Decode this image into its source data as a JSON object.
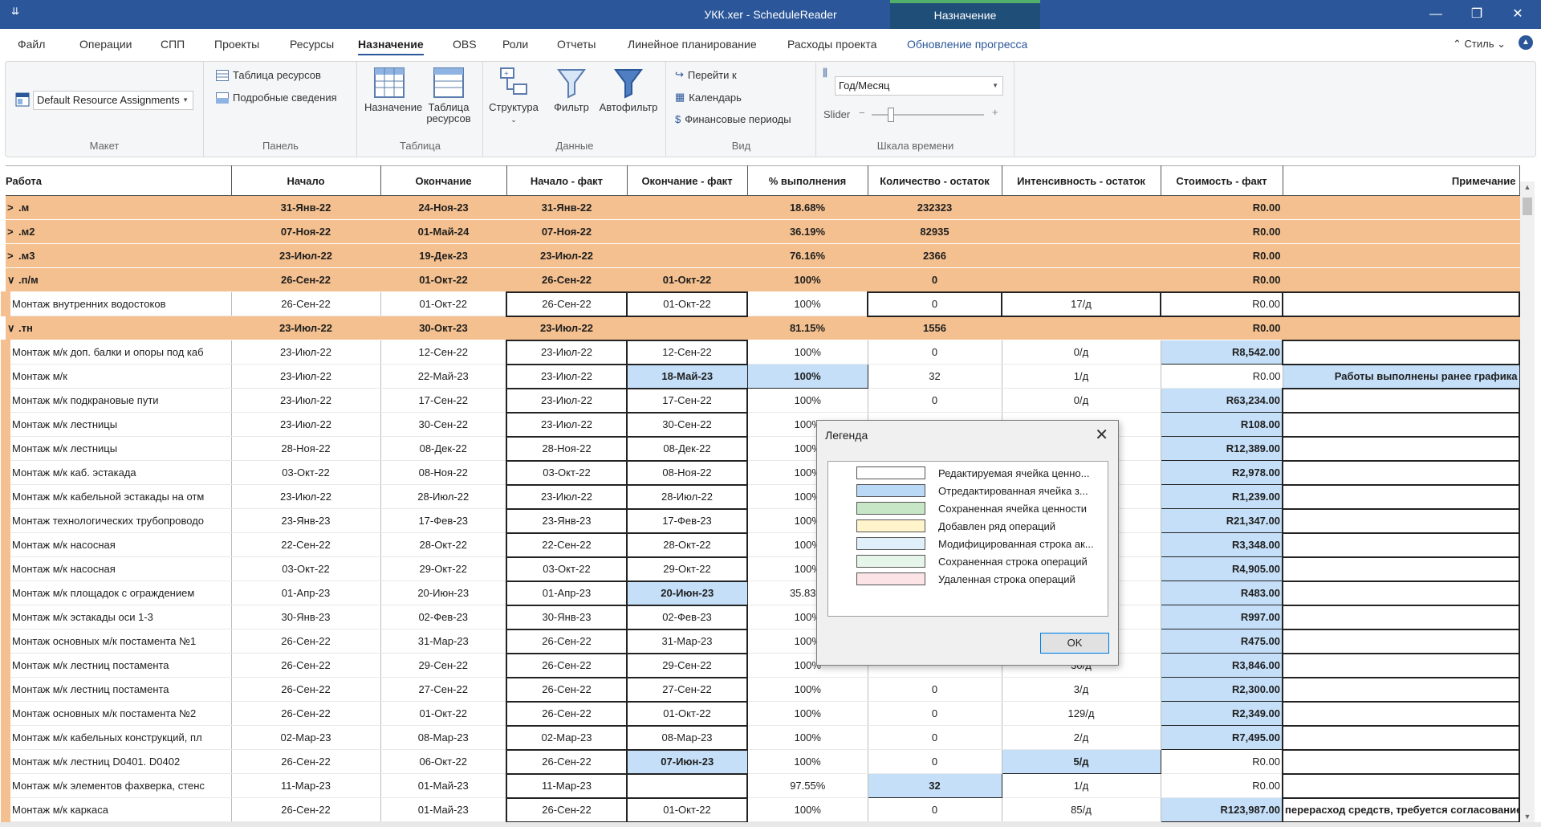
{
  "window": {
    "qa_menu": "⇊",
    "title": "УКК.xer - ScheduleReader",
    "context_tab": "Назначение",
    "buttons": {
      "minimize": "—",
      "restore": "❐",
      "close": "✕"
    }
  },
  "ribbon_tabs": [
    {
      "label": "Файл"
    },
    {
      "label": "Операции"
    },
    {
      "label": "СПП"
    },
    {
      "label": "Проекты"
    },
    {
      "label": "Ресурсы"
    },
    {
      "label": "Назначение",
      "active": true
    },
    {
      "label": "OBS"
    },
    {
      "label": "Роли"
    },
    {
      "label": "Отчеты"
    },
    {
      "label": "Линейное планирование"
    },
    {
      "label": "Расходы проекта"
    },
    {
      "label": "Обновление прогресса"
    }
  ],
  "style_menu": "⌃ Стиль ⌄",
  "ribbon": {
    "maket": {
      "caption": "Макет",
      "layout_value": "Default Resource Assignments"
    },
    "panel": {
      "caption": "Панель",
      "resource_table": "Таблица ресурсов",
      "details": "Подробные сведения"
    },
    "table": {
      "caption": "Таблица",
      "assignment": "Назначение",
      "resource_table_1": "Таблица",
      "resource_table_2": "ресурсов"
    },
    "data": {
      "caption": "Данные",
      "structure": "Структура",
      "filter": "Фильтр",
      "autofilter": "Автофильтр"
    },
    "view": {
      "caption": "Вид",
      "goto": "Перейти к",
      "calendar": "Календарь",
      "fin_periods": "Финансовые периоды"
    },
    "timescale": {
      "caption": "Шкала времени",
      "value": "Год/Месяц",
      "slider_label": "Slider",
      "slider_level": 0.15
    }
  },
  "columns": [
    "Работа",
    "Начало",
    "Окончание",
    "Начало - факт",
    "Окончание - факт",
    "% выполнения",
    "Количество - остаток",
    "Интенсивность - остаток",
    "Стоимость - факт",
    "Примечание"
  ],
  "rows": [
    {
      "g": 1,
      "caret": ">",
      "c": [
        ".м",
        "31-Янв-22",
        "24-Ноя-23",
        "31-Янв-22",
        "",
        "18.68%",
        "232323",
        "",
        "R0.00",
        ""
      ]
    },
    {
      "g": 1,
      "caret": ">",
      "c": [
        ".м2",
        "07-Ноя-22",
        "01-Май-24",
        "07-Ноя-22",
        "",
        "36.19%",
        "82935",
        "",
        "R0.00",
        ""
      ]
    },
    {
      "g": 1,
      "caret": ">",
      "c": [
        ".м3",
        "23-Июл-22",
        "19-Дек-23",
        "23-Июл-22",
        "",
        "76.16%",
        "2366",
        "",
        "R0.00",
        ""
      ]
    },
    {
      "g": 1,
      "caret": "∨",
      "c": [
        ".п/м",
        "26-Сен-22",
        "01-Окт-22",
        "26-Сен-22",
        "01-Окт-22",
        "100%",
        "0",
        "",
        "R0.00",
        ""
      ]
    },
    {
      "g": 0,
      "c": [
        "Монтаж внутренних водостоков",
        "26-Сен-22",
        "01-Окт-22",
        "26-Сен-22",
        "01-Окт-22",
        "100%",
        "0",
        "17/д",
        "R0.00",
        ""
      ],
      "ed": [
        3,
        4,
        6,
        7,
        8,
        9
      ]
    },
    {
      "g": 1,
      "caret": "∨",
      "c": [
        ".тн",
        "23-Июл-22",
        "30-Окт-23",
        "23-Июл-22",
        "",
        "81.15%",
        "1556",
        "",
        "R0.00",
        ""
      ]
    },
    {
      "g": 0,
      "c": [
        "Монтаж м/к доп. балки и опоры под каб",
        "23-Июл-22",
        "12-Сен-22",
        "23-Июл-22",
        "12-Сен-22",
        "100%",
        "0",
        "0/д",
        "R8,542.00",
        ""
      ],
      "ed": [
        3,
        4,
        9
      ],
      "mod": [
        8
      ]
    },
    {
      "g": 0,
      "c": [
        "Монтаж м/к",
        "23-Июл-22",
        "22-Май-23",
        "23-Июл-22",
        "18-Май-23",
        "100%",
        "32",
        "1/д",
        "R0.00",
        "Работы выполнены ранее графика"
      ],
      "ed": [
        3
      ],
      "mod": [
        4,
        5,
        9
      ]
    },
    {
      "g": 0,
      "c": [
        "Монтаж м/к подкрановые пути",
        "23-Июл-22",
        "17-Сен-22",
        "23-Июл-22",
        "17-Сен-22",
        "100%",
        "0",
        "0/д",
        "R63,234.00",
        ""
      ],
      "ed": [
        3,
        4,
        9
      ],
      "mod": [
        8
      ]
    },
    {
      "g": 0,
      "c": [
        "Монтаж м/к лестницы",
        "23-Июл-22",
        "30-Сен-22",
        "23-Июл-22",
        "30-Сен-22",
        "100%",
        "",
        "",
        "R108.00",
        ""
      ],
      "ed": [
        3,
        4,
        9
      ],
      "mod": [
        8
      ]
    },
    {
      "g": 0,
      "c": [
        "Монтаж м/к лестницы",
        "28-Ноя-22",
        "08-Дек-22",
        "28-Ноя-22",
        "08-Дек-22",
        "100%",
        "",
        "",
        "R12,389.00",
        ""
      ],
      "ed": [
        3,
        4,
        9
      ],
      "mod": [
        8
      ]
    },
    {
      "g": 0,
      "c": [
        "Монтаж м/к каб. эстакада",
        "03-Окт-22",
        "08-Ноя-22",
        "03-Окт-22",
        "08-Ноя-22",
        "100%",
        "",
        "",
        "R2,978.00",
        ""
      ],
      "ed": [
        3,
        4,
        9
      ],
      "mod": [
        8
      ]
    },
    {
      "g": 0,
      "c": [
        "Монтаж м/к кабельной эстакады на отм",
        "23-Июл-22",
        "28-Июл-22",
        "23-Июл-22",
        "28-Июл-22",
        "100%",
        "",
        "",
        "R1,239.00",
        ""
      ],
      "ed": [
        3,
        4,
        9
      ],
      "mod": [
        8
      ]
    },
    {
      "g": 0,
      "c": [
        "Монтаж технологических трубопроводо",
        "23-Янв-23",
        "17-Фев-23",
        "23-Янв-23",
        "17-Фев-23",
        "100%",
        "",
        "",
        "R21,347.00",
        ""
      ],
      "ed": [
        3,
        4,
        9
      ],
      "mod": [
        8
      ]
    },
    {
      "g": 0,
      "c": [
        "Монтаж м/к насосная",
        "22-Сен-22",
        "28-Окт-22",
        "22-Сен-22",
        "28-Окт-22",
        "100%",
        "",
        "",
        "R3,348.00",
        ""
      ],
      "ed": [
        3,
        4,
        9
      ],
      "mod": [
        8
      ]
    },
    {
      "g": 0,
      "c": [
        "Монтаж м/к насосная",
        "03-Окт-22",
        "29-Окт-22",
        "03-Окт-22",
        "29-Окт-22",
        "100%",
        "",
        "",
        "R4,905.00",
        ""
      ],
      "ed": [
        3,
        4,
        9
      ],
      "mod": [
        8
      ]
    },
    {
      "g": 0,
      "c": [
        "Монтаж м/к площадок с ограждением",
        "01-Апр-23",
        "20-Июн-23",
        "01-Апр-23",
        "20-Июн-23",
        "35.83%",
        "",
        "",
        "R483.00",
        ""
      ],
      "ed": [
        3,
        9
      ],
      "mod": [
        4,
        8
      ]
    },
    {
      "g": 0,
      "c": [
        "Монтаж м/к эстакады оси 1-3",
        "30-Янв-23",
        "02-Фев-23",
        "30-Янв-23",
        "02-Фев-23",
        "100%",
        "",
        "",
        "R997.00",
        ""
      ],
      "ed": [
        3,
        4,
        9
      ],
      "mod": [
        8
      ]
    },
    {
      "g": 0,
      "c": [
        "Монтаж основных м/к постамента №1",
        "26-Сен-22",
        "31-Мар-23",
        "26-Сен-22",
        "31-Мар-23",
        "100%",
        "",
        "",
        "R475.00",
        ""
      ],
      "ed": [
        3,
        4,
        9
      ],
      "mod": [
        8
      ]
    },
    {
      "g": 0,
      "c": [
        "Монтаж м/к лестниц постамента",
        "26-Сен-22",
        "29-Сен-22",
        "26-Сен-22",
        "29-Сен-22",
        "100%",
        "",
        "30/д",
        "R3,846.00",
        ""
      ],
      "ed": [
        3,
        4,
        9
      ],
      "mod": [
        8
      ]
    },
    {
      "g": 0,
      "c": [
        "Монтаж м/к лестниц постамента",
        "26-Сен-22",
        "27-Сен-22",
        "26-Сен-22",
        "27-Сен-22",
        "100%",
        "0",
        "3/д",
        "R2,300.00",
        ""
      ],
      "ed": [
        3,
        4,
        9
      ],
      "mod": [
        8
      ]
    },
    {
      "g": 0,
      "c": [
        "Монтаж основных м/к постамента №2",
        "26-Сен-22",
        "01-Окт-22",
        "26-Сен-22",
        "01-Окт-22",
        "100%",
        "0",
        "129/д",
        "R2,349.00",
        ""
      ],
      "ed": [
        3,
        4,
        9
      ],
      "mod": [
        8
      ]
    },
    {
      "g": 0,
      "c": [
        "Монтаж м/к кабельных конструкций, пл",
        "02-Мар-23",
        "08-Мар-23",
        "02-Мар-23",
        "08-Мар-23",
        "100%",
        "0",
        "2/д",
        "R7,495.00",
        ""
      ],
      "ed": [
        3,
        4,
        9
      ],
      "mod": [
        8
      ]
    },
    {
      "g": 0,
      "c": [
        "Монтаж м/к лестниц D0401. D0402",
        "26-Сен-22",
        "06-Окт-22",
        "26-Сен-22",
        "07-Июн-23",
        "100%",
        "0",
        "5/д",
        "R0.00",
        ""
      ],
      "ed": [
        3,
        9
      ],
      "mod": [
        4,
        7
      ]
    },
    {
      "g": 0,
      "c": [
        "Монтаж м/к элементов фахверка, стенс",
        "11-Мар-23",
        "01-Май-23",
        "11-Мар-23",
        "",
        "97.55%",
        "32",
        "1/д",
        "R0.00",
        ""
      ],
      "ed": [
        3,
        4,
        9
      ],
      "mod": [
        6
      ]
    },
    {
      "g": 0,
      "c": [
        "Монтаж м/к каркаса",
        "26-Сен-22",
        "01-Май-23",
        "26-Сен-22",
        "01-Окт-22",
        "100%",
        "0",
        "85/д",
        "R123,987.00",
        "перерасход средств, требуется согласование"
      ],
      "ed": [
        3,
        4,
        9
      ],
      "mod": [
        8
      ]
    }
  ],
  "legend": {
    "title": "Легенда",
    "close": "✕",
    "ok": "OK",
    "items": [
      {
        "label": "Редактируемая ячейка ценно...",
        "color": "#ffffff"
      },
      {
        "label": "Отредактированная ячейка з...",
        "color": "#b9d9f7"
      },
      {
        "label": "Сохраненная ячейка ценности",
        "color": "#c6e6c6"
      },
      {
        "label": "Добавлен ряд операций",
        "color": "#fff4cc"
      },
      {
        "label": "Модифицированная строка ак...",
        "color": "#dff0fb"
      },
      {
        "label": "Сохраненная строка операций",
        "color": "#e6f5e9"
      },
      {
        "label": "Удаленная строка операций",
        "color": "#fbe3e6"
      }
    ]
  }
}
